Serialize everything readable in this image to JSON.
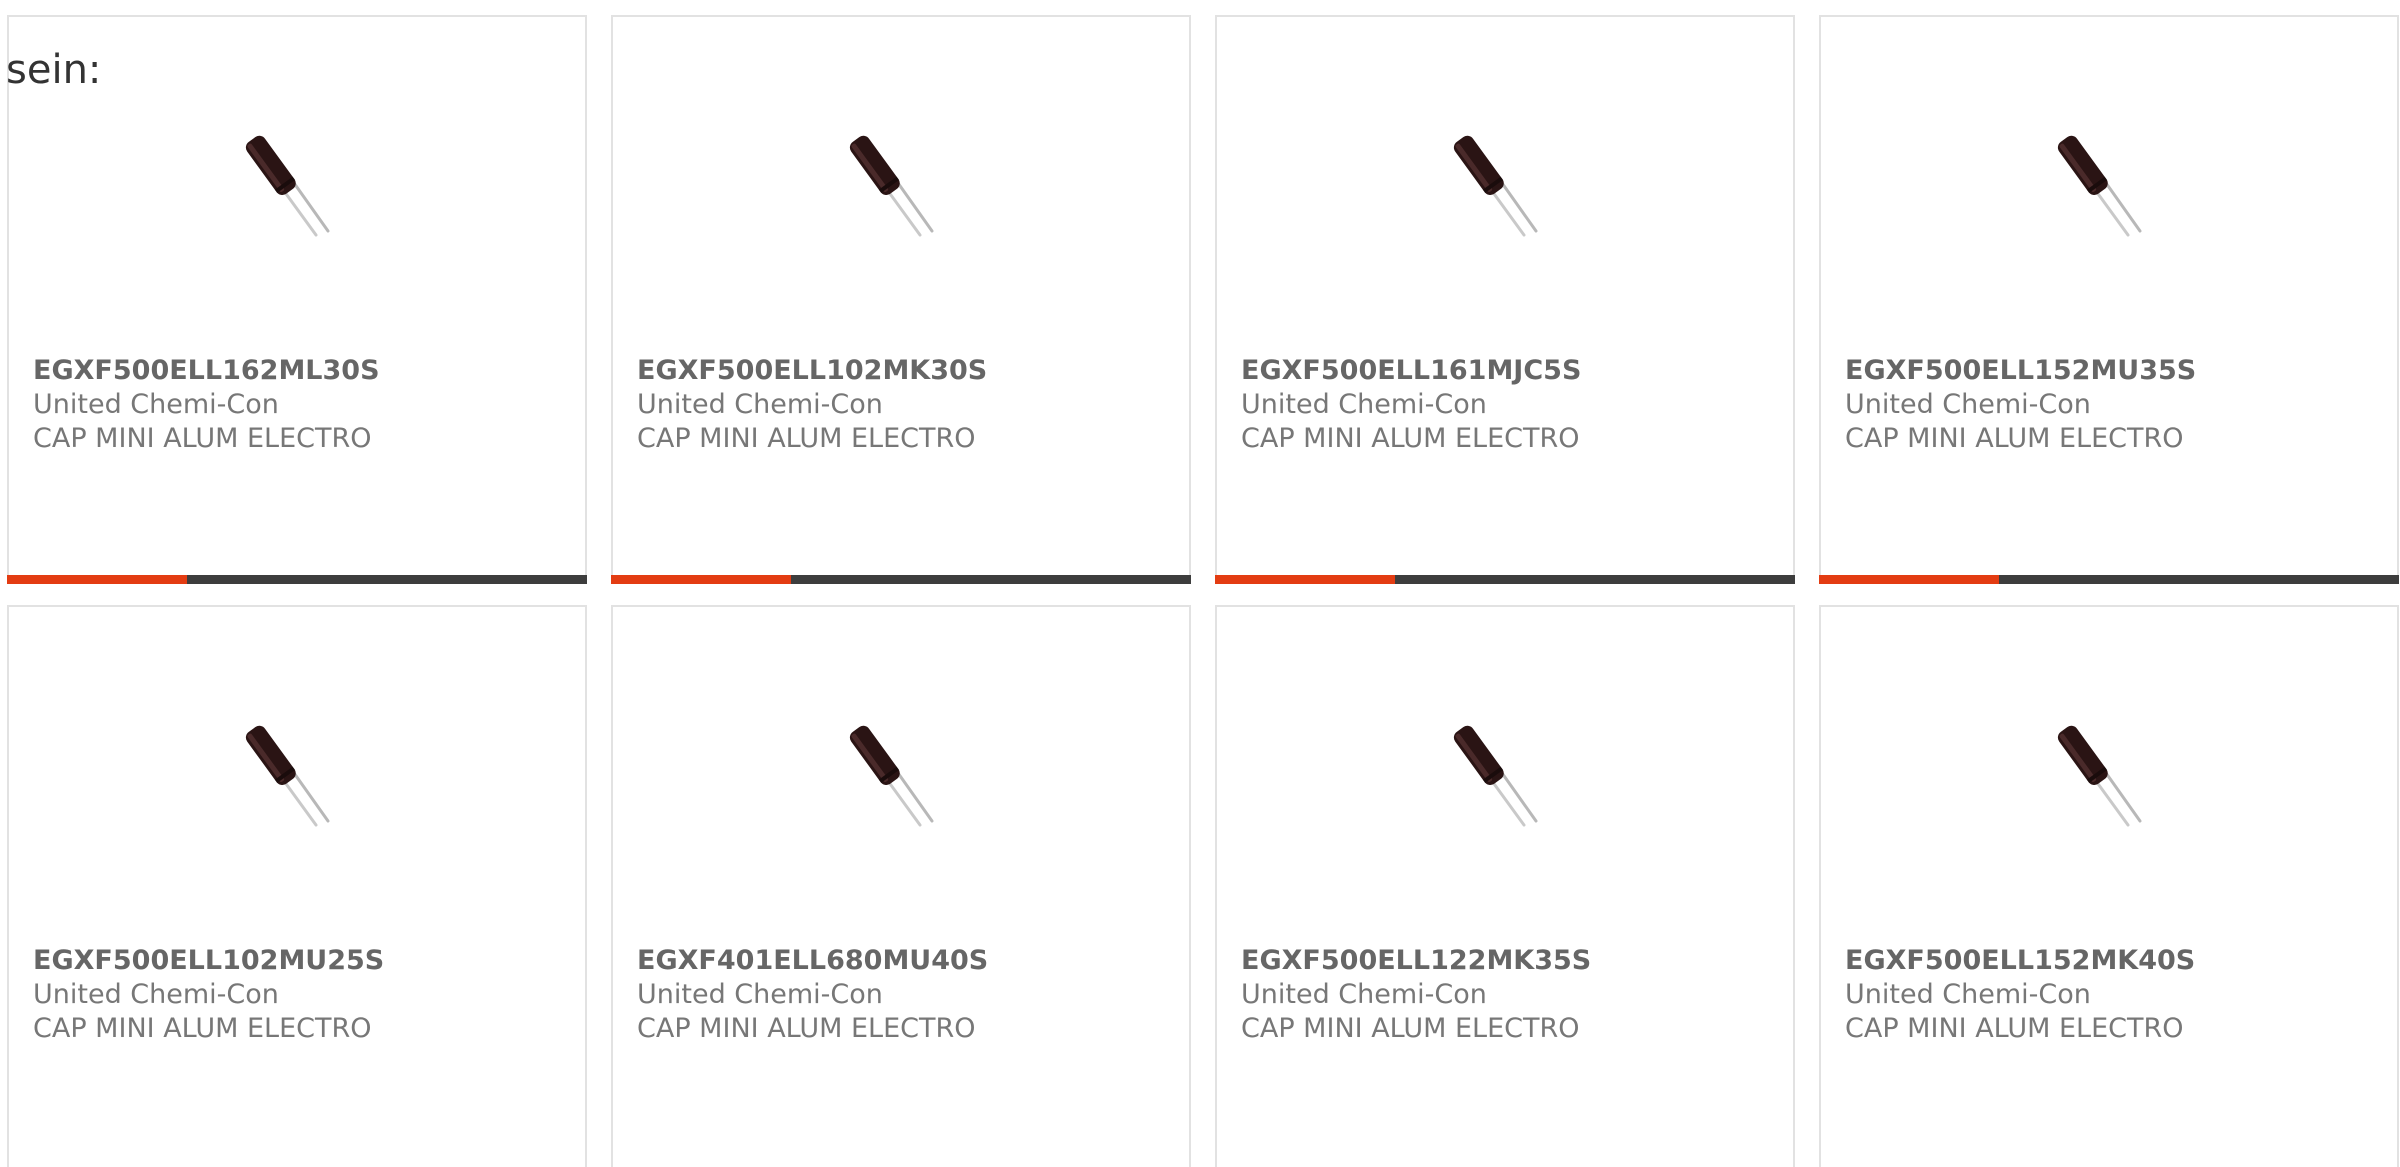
{
  "heading": "sein:",
  "colors": {
    "progress_fill": "#e33c12",
    "progress_track": "#3d3d3d",
    "card_border": "#e2e2e2"
  },
  "products": [
    {
      "part": "EGXF500ELL162ML30S",
      "manufacturer": "United Chemi-Con",
      "description": "CAP MINI ALUM ELECTRO",
      "icon": "capacitor-image",
      "progress": 0.31
    },
    {
      "part": "EGXF500ELL102MK30S",
      "manufacturer": "United Chemi-Con",
      "description": "CAP MINI ALUM ELECTRO",
      "icon": "capacitor-image",
      "progress": 0.31
    },
    {
      "part": "EGXF500ELL161MJC5S",
      "manufacturer": "United Chemi-Con",
      "description": "CAP MINI ALUM ELECTRO",
      "icon": "capacitor-image",
      "progress": 0.31
    },
    {
      "part": "EGXF500ELL152MU35S",
      "manufacturer": "United Chemi-Con",
      "description": "CAP MINI ALUM ELECTRO",
      "icon": "capacitor-image",
      "progress": 0.31
    },
    {
      "part": "EGXF500ELL102MU25S",
      "manufacturer": "United Chemi-Con",
      "description": "CAP MINI ALUM ELECTRO",
      "icon": "capacitor-image"
    },
    {
      "part": "EGXF401ELL680MU40S",
      "manufacturer": "United Chemi-Con",
      "description": "CAP MINI ALUM ELECTRO",
      "icon": "capacitor-image"
    },
    {
      "part": "EGXF500ELL122MK35S",
      "manufacturer": "United Chemi-Con",
      "description": "CAP MINI ALUM ELECTRO",
      "icon": "capacitor-image"
    },
    {
      "part": "EGXF500ELL152MK40S",
      "manufacturer": "United Chemi-Con",
      "description": "CAP MINI ALUM ELECTRO",
      "icon": "capacitor-image"
    }
  ]
}
